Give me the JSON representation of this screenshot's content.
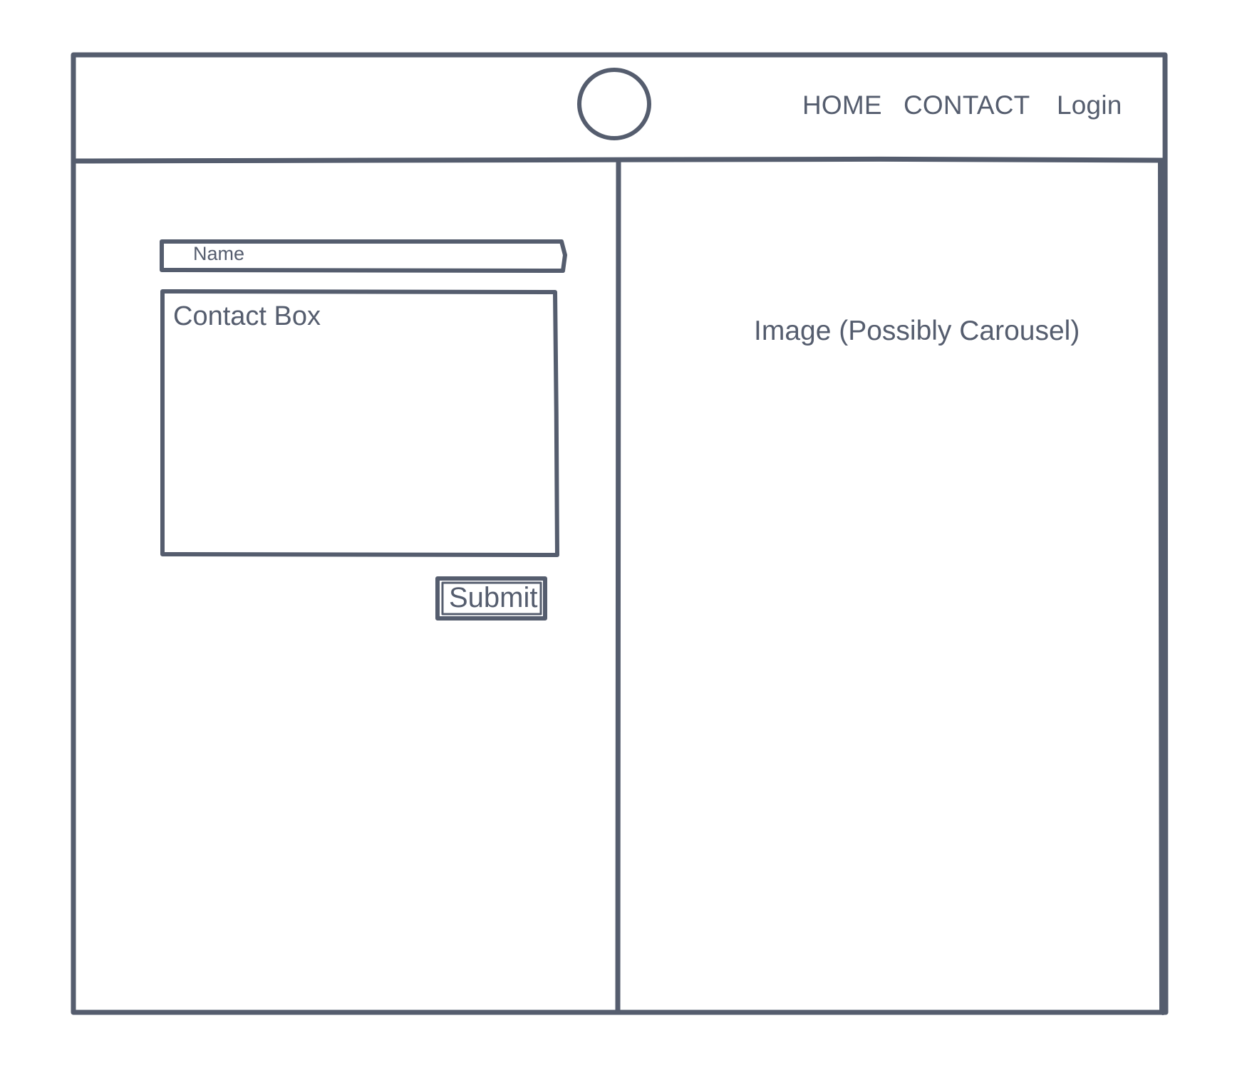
{
  "header": {
    "logo_icon": "circle-logo-icon",
    "nav": {
      "home_label": "HOME",
      "contact_label": "CONTACT",
      "login_label": "Login"
    }
  },
  "form": {
    "name_field_label": "Name",
    "contact_box_label": "Contact Box",
    "submit_label": "Submit"
  },
  "image_panel": {
    "label": "Image (Possibly Carousel)"
  },
  "colors": {
    "stroke": "#555d6e",
    "background": "#ffffff"
  }
}
